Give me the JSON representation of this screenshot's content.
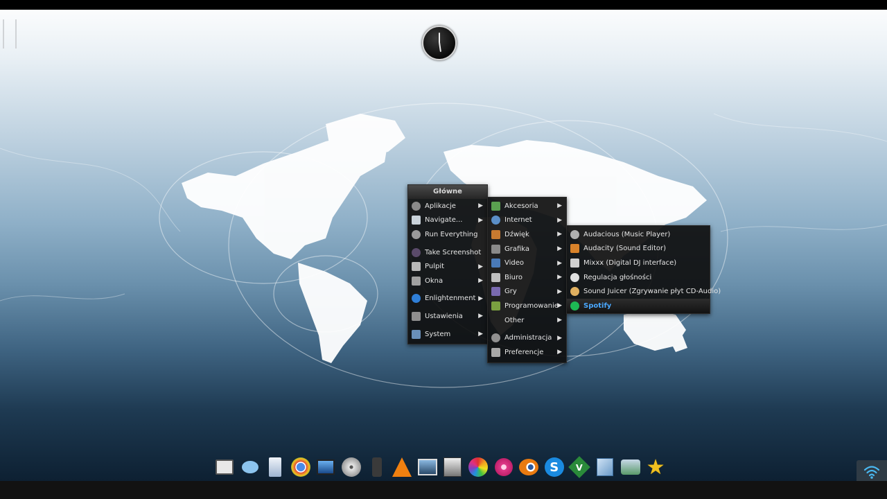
{
  "menu": {
    "title": "Główne",
    "items": [
      {
        "label": "Aplikacje",
        "icon": "apps-icon",
        "color": "#8a8a8a",
        "submenu": true
      },
      {
        "label": "Navigate...",
        "icon": "folder-icon",
        "color": "#c9d2da",
        "submenu": true
      },
      {
        "label": "Run Everything",
        "icon": "gears-icon",
        "color": "#9a9a9a",
        "submenu": false
      },
      {
        "label": "Take Screenshot",
        "icon": "camera-icon",
        "color": "#5a4a6a",
        "submenu": false
      },
      {
        "label": "Pulpit",
        "icon": "desktop-icon",
        "color": "#b8b8b8",
        "submenu": true
      },
      {
        "label": "Okna",
        "icon": "windows-icon",
        "color": "#a0a0a0",
        "submenu": true
      },
      {
        "label": "Enlightenment",
        "icon": "enlightenment-icon",
        "color": "#2f7fd8",
        "submenu": true
      },
      {
        "label": "Ustawienia",
        "icon": "tools-icon",
        "color": "#8f8f8f",
        "submenu": true
      },
      {
        "label": "System",
        "icon": "monitor-icon",
        "color": "#6a8fb8",
        "submenu": true
      }
    ]
  },
  "submenu_apps": {
    "items": [
      {
        "label": "Akcesoria",
        "icon": "accessories-icon",
        "color": "#5aa050"
      },
      {
        "label": "Internet",
        "icon": "globe-icon",
        "color": "#5b8fc8"
      },
      {
        "label": "Dźwięk",
        "icon": "guitar-icon",
        "color": "#c87a30"
      },
      {
        "label": "Grafika",
        "icon": "brush-icon",
        "color": "#8a8a8a"
      },
      {
        "label": "Video",
        "icon": "video-icon",
        "color": "#4a7ab8"
      },
      {
        "label": "Biuro",
        "icon": "office-icon",
        "color": "#c0c0c0"
      },
      {
        "label": "Gry",
        "icon": "games-icon",
        "color": "#7a6ab0"
      },
      {
        "label": "Programowanie",
        "icon": "programming-icon",
        "color": "#7aa040"
      },
      {
        "label": "Other",
        "icon": "",
        "color": "transparent"
      },
      {
        "label": "Administracja",
        "icon": "admin-icon",
        "color": "#909090"
      },
      {
        "label": "Preferencje",
        "icon": "preferences-icon",
        "color": "#a8a8a8"
      }
    ]
  },
  "submenu_sound": {
    "items": [
      {
        "label": "Audacious (Music Player)",
        "icon": "audacious-icon",
        "color": "#b0b0b0"
      },
      {
        "label": "Audacity (Sound Editor)",
        "icon": "audacity-icon",
        "color": "#d8822a"
      },
      {
        "label": "Mixxx (Digital DJ interface)",
        "icon": "mixxx-icon",
        "color": "#d0d0d0"
      },
      {
        "label": "Regulacja głośności",
        "icon": "volume-icon",
        "color": "#e0e0e0"
      },
      {
        "label": "Sound Juicer (Zgrywanie płyt CD-Audio)",
        "icon": "cd-icon",
        "color": "#e0b060"
      },
      {
        "label": "Spotify",
        "icon": "spotify-icon",
        "color": "#1db954"
      }
    ]
  },
  "dock": [
    {
      "name": "terminal-icon",
      "color": "#d8d8d8",
      "glyph": ""
    },
    {
      "name": "chat-icon",
      "color": "#7ab8e8",
      "glyph": ""
    },
    {
      "name": "files-icon",
      "color": "#c8d8ec",
      "glyph": ""
    },
    {
      "name": "chrome-icon",
      "color": "#5b8fd8",
      "glyph": ""
    },
    {
      "name": "image-viewer-icon",
      "color": "#3a7ac8",
      "glyph": ""
    },
    {
      "name": "disc-burner-icon",
      "color": "#c8c8c8",
      "glyph": ""
    },
    {
      "name": "media-player-icon",
      "color": "#5a5a5a",
      "glyph": ""
    },
    {
      "name": "vlc-icon",
      "color": "#f08010",
      "glyph": ""
    },
    {
      "name": "screenshot-icon",
      "color": "#4a6a8a",
      "glyph": ""
    },
    {
      "name": "photo-icon",
      "color": "#8a8a8a",
      "glyph": ""
    },
    {
      "name": "color-wheel-icon",
      "color": "#e04040",
      "glyph": ""
    },
    {
      "name": "flower-icon",
      "color": "#e03a8a",
      "glyph": ""
    },
    {
      "name": "blender-icon",
      "color": "#e87a10",
      "glyph": ""
    },
    {
      "name": "skype-icon",
      "color": "#1a8ae0",
      "glyph": "S"
    },
    {
      "name": "vim-icon",
      "color": "#2a8a3a",
      "glyph": "V"
    },
    {
      "name": "virtualbox-icon",
      "color": "#6a9ac8",
      "glyph": ""
    },
    {
      "name": "network-icon",
      "color": "#5a9a6a",
      "glyph": ""
    },
    {
      "name": "favorites-star-icon",
      "color": "#f0c020",
      "glyph": "★"
    }
  ]
}
